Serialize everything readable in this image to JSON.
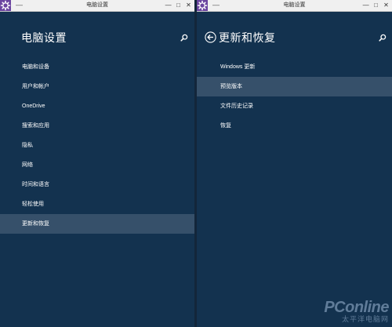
{
  "left_window": {
    "title": "电脑设置",
    "menu_glyph": "—",
    "page_title": "电脑设置",
    "nav_items": [
      {
        "label": "电脑和设备"
      },
      {
        "label": "用户和帐户"
      },
      {
        "label": "OneDrive"
      },
      {
        "label": "搜索和应用"
      },
      {
        "label": "隐私"
      },
      {
        "label": "网络"
      },
      {
        "label": "时间和语言"
      },
      {
        "label": "轻松使用"
      },
      {
        "label": "更新和恢复",
        "selected": true
      }
    ]
  },
  "right_window": {
    "title": "电脑设置",
    "menu_glyph": "—",
    "page_title": "更新和恢复",
    "nav_items": [
      {
        "label": "Windows 更新"
      },
      {
        "label": "预览版本",
        "selected": true
      },
      {
        "label": "文件历史记录"
      },
      {
        "label": "恢复"
      }
    ]
  },
  "window_controls": {
    "minimize": "—",
    "maximize": "□",
    "close": "✕"
  },
  "watermark": {
    "logo": "PConline",
    "subtitle": "太平洋电脑网"
  },
  "colors": {
    "background": "#13324f",
    "selected_item": "#36506a",
    "title_bar": "#f0f0f0",
    "app_icon": "#6b45a0"
  },
  "icons": [
    "gear-icon",
    "search-icon",
    "back-arrow-icon",
    "minimize-icon",
    "maximize-icon",
    "close-icon"
  ]
}
